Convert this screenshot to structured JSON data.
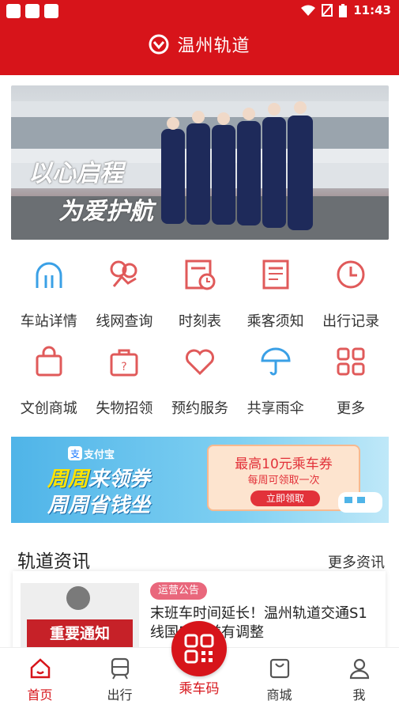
{
  "status": {
    "time": "11:43"
  },
  "header": {
    "title": "温州轨道"
  },
  "banner": {
    "line1": "以心启程",
    "line2": "为爱护航"
  },
  "grid": [
    {
      "label": "车站详情",
      "icon": "station-icon"
    },
    {
      "label": "线网查询",
      "icon": "network-icon"
    },
    {
      "label": "时刻表",
      "icon": "timetable-icon"
    },
    {
      "label": "乘客须知",
      "icon": "notice-icon"
    },
    {
      "label": "出行记录",
      "icon": "clock-icon"
    },
    {
      "label": "文创商城",
      "icon": "shopping-bag-icon"
    },
    {
      "label": "失物招领",
      "icon": "lost-found-icon"
    },
    {
      "label": "预约服务",
      "icon": "heart-icon"
    },
    {
      "label": "共享雨伞",
      "icon": "umbrella-icon"
    },
    {
      "label": "更多",
      "icon": "more-grid-icon"
    }
  ],
  "ad": {
    "pay": "支付宝",
    "headline1_a": "周周",
    "headline1_b": "来领券",
    "headline2": "周周省钱坐",
    "coupon_title": "最高10元乘车券",
    "coupon_sub": "每周可领取一次",
    "coupon_btn": "立即领取"
  },
  "news": {
    "header": "轨道资讯",
    "more": "更多资讯",
    "thumb_text": "重要通知",
    "tag": "运营公告",
    "title": "末班车时间延长！温州轨道交通S1线国庆节前有调整"
  },
  "tabbar": {
    "home": "首页",
    "travel": "出行",
    "qr": "乘车码",
    "mall": "商城",
    "me": "我"
  },
  "colors": {
    "brand": "#d7141a",
    "icon_red": "#e05a5a",
    "icon_blue": "#3aa0e6"
  }
}
